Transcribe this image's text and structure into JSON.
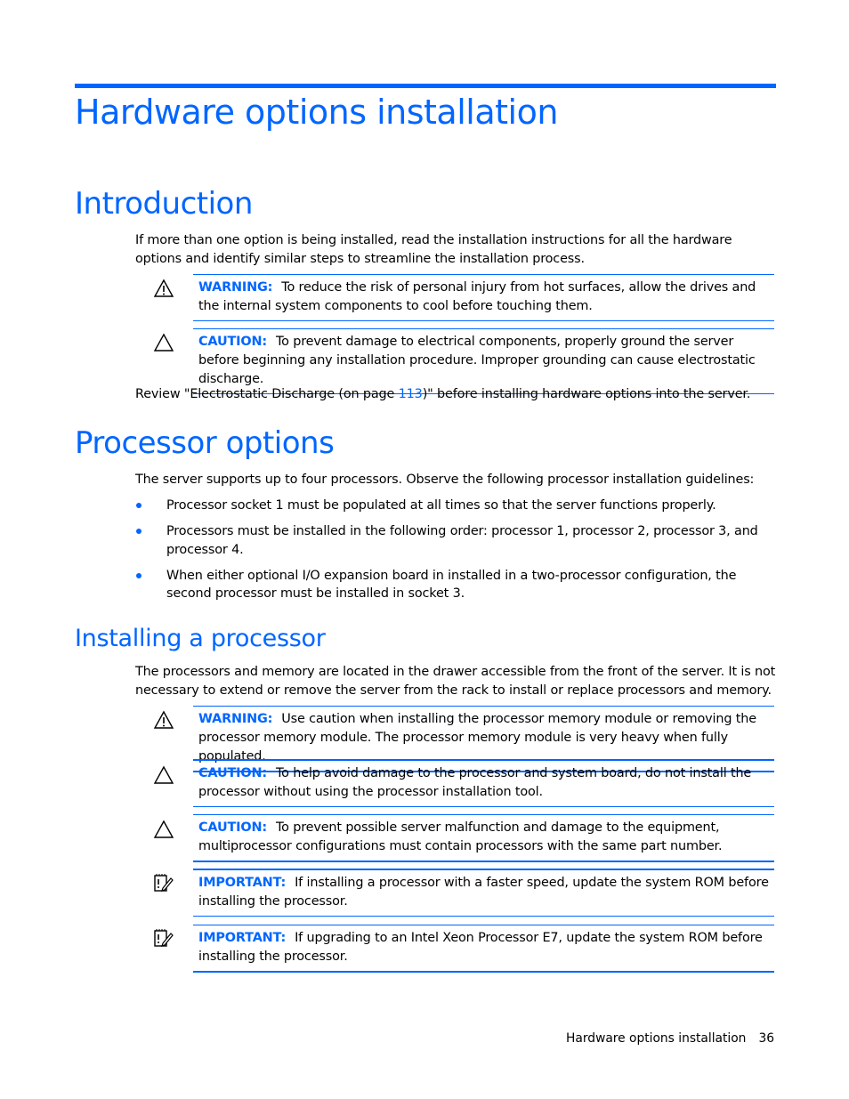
{
  "page_title": "Hardware options installation",
  "sections": {
    "introduction": {
      "heading": "Introduction",
      "paragraph": "If more than one option is being installed, read the installation instructions for all the hardware options and identify similar steps to streamline the installation process.",
      "notes": [
        {
          "type": "warning",
          "icon": "warning-triangle-exclamation-icon",
          "label": "WARNING:",
          "text": "To reduce the risk of personal injury from hot surfaces, allow the drives and the internal system components to cool before touching them."
        },
        {
          "type": "caution",
          "icon": "caution-triangle-icon",
          "label": "CAUTION:",
          "text": "To prevent damage to electrical components, properly ground the server before beginning any installation procedure. Improper grounding can cause electrostatic discharge."
        }
      ],
      "review": {
        "before": "Review \"Electrostatic Discharge (on page ",
        "link": "113",
        "after": ")\" before installing hardware options into the server."
      }
    },
    "processor_options": {
      "heading": "Processor options",
      "paragraph": "The server supports up to four processors. Observe the following processor installation guidelines:",
      "bullets": [
        "Processor socket 1 must be populated at all times so that the server functions properly.",
        "Processors must be installed in the following order: processor 1, processor 2, processor 3, and processor 4.",
        "When either optional I/O expansion board in installed in a two-processor configuration, the second processor must be installed in socket 3."
      ]
    },
    "installing_processor": {
      "heading": "Installing a processor",
      "paragraph": "The processors and memory are located in the drawer accessible from the front of the server. It is not necessary to extend or remove the server from the rack to install or replace processors and memory.",
      "notes": [
        {
          "type": "warning",
          "icon": "warning-triangle-exclamation-icon",
          "label": "WARNING:",
          "text": "Use caution when installing the processor memory module or removing the processor memory module. The processor memory module is very heavy when fully populated."
        },
        {
          "type": "caution",
          "icon": "caution-triangle-icon",
          "label": "CAUTION:",
          "text": "To help avoid damage to the processor and system board, do not install the processor without using the processor installation tool."
        },
        {
          "type": "caution",
          "icon": "caution-triangle-icon",
          "label": "CAUTION:",
          "text": "To prevent possible server malfunction and damage to the equipment, multiprocessor configurations must contain processors with the same part number."
        },
        {
          "type": "important",
          "icon": "important-notepad-icon",
          "label": "IMPORTANT:",
          "text": "If installing a processor with a faster speed, update the system ROM before installing the processor."
        },
        {
          "type": "important",
          "icon": "important-notepad-icon",
          "label": "IMPORTANT:",
          "text": "If upgrading to an Intel Xeon Processor E7, update the system ROM before installing the processor."
        }
      ]
    }
  },
  "footer": {
    "section": "Hardware options installation",
    "page_number": "36"
  },
  "colors": {
    "accent": "#0066ff",
    "text": "#000000"
  }
}
